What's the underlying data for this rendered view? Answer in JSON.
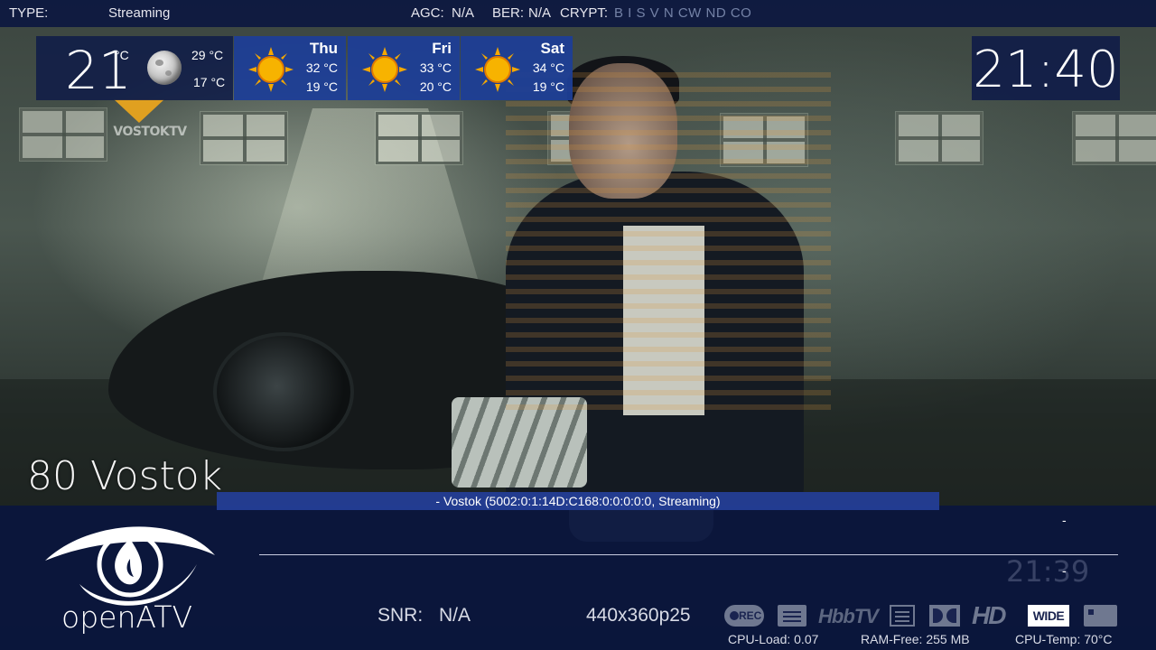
{
  "topbar": {
    "type_label": "TYPE:",
    "type_value": "Streaming",
    "agc_label": "AGC:",
    "agc_value": "N/A",
    "ber_label": "BER:",
    "ber_value": "N/A",
    "crypt_label": "CRYPT:",
    "crypt_flags": "B  I  S  V  N  CW  ND  CO"
  },
  "weather": {
    "current_temp": "21",
    "current_unit": "°C",
    "current_icon": "moon-icon",
    "today_high": "29 °C",
    "today_low": "17 °C",
    "forecast": [
      {
        "day": "Thu",
        "high": "32 °C",
        "low": "19 °C",
        "icon": "sun-icon"
      },
      {
        "day": "Fri",
        "high": "33 °C",
        "low": "20 °C",
        "icon": "sun-icon"
      },
      {
        "day": "Sat",
        "high": "34 °C",
        "low": "19 °C",
        "icon": "sun-icon"
      }
    ]
  },
  "clock": "21:40",
  "channel_logo_text": "VOSTOKTV",
  "channel": {
    "number_name": "80 Vostok"
  },
  "event": {
    "service_line": "- Vostok (5002:0:1:14D:C168:0:0:0:0:0, Streaming)",
    "now_dash": "-",
    "next_time": "21:39",
    "next_dash": "-"
  },
  "brand": {
    "logo_text": "openATV"
  },
  "signal": {
    "snr_label": "SNR:",
    "snr_value": "N/A",
    "resolution": "440x360p25"
  },
  "indicators": {
    "rec": "REC",
    "hbbtv": "HbbTV",
    "hd": "HD",
    "wide": "WIDE"
  },
  "system": {
    "cpu_load": "CPU-Load: 0.07",
    "ram_free": "RAM-Free: 255 MB",
    "cpu_temp": "CPU-Temp: 70°C"
  },
  "colors": {
    "bar_background": "#0c1840",
    "forecast_tile": "#1e3e96",
    "event_strip": "#243e96",
    "sun": "#f5a800",
    "inactive_indicator": "#6f7890"
  }
}
